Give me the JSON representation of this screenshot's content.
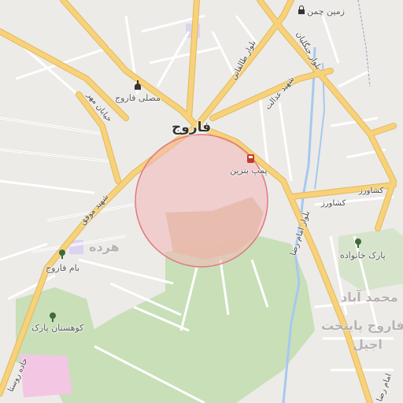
{
  "map": {
    "city_name": "فاروج",
    "districts": {
      "harde": "هرده",
      "mohammad_abad": "محمد آباد",
      "farooj_paytakht": "فاروج پایتخت",
      "ajil": "اجیل"
    },
    "roads": {
      "bolvar_taleghani": "بلوار طالقانی",
      "bolvar_jangalian": "بلوار جنگلیان",
      "shahid_edalat": "شهید عدالت",
      "khiaban_mehr": "خیابان مهر",
      "shahid_movafagh": "شهید موفق",
      "keshavarz_1": "کشاورز",
      "keshavarz_2": "کشاورز",
      "bolvar_imam_reza": "بلوار امام رضا",
      "jade_roosta": "جاده روستا",
      "imam_reza_bottom": "امام رضا"
    },
    "pois": {
      "zamin_chaman": "زمین چمن",
      "mosala_farooj": "مصلی فاروج",
      "pomp_benzin": "پمپ بنزین",
      "park_khanevadeh": "پارک خانواده",
      "bam_farooj": "بام فاروج",
      "park_kuhestan": "کوهستان پارک"
    },
    "colors": {
      "background": "#ecebe8",
      "road_major": "#f7d27b",
      "road_major_edge": "#e3b95a",
      "road_minor": "#ffffff",
      "park": "#c8dfb8",
      "pink_area": "#f3c6e4",
      "river": "#a8c8ee",
      "circle_fill": "#f4b6b8",
      "circle_stroke": "#e07a80"
    },
    "icons": {
      "zamin_chaman": "sports-field-icon",
      "mosala": "mosque-icon",
      "pomp_benzin": "fuel-station-icon",
      "park": "tree-icon"
    }
  }
}
